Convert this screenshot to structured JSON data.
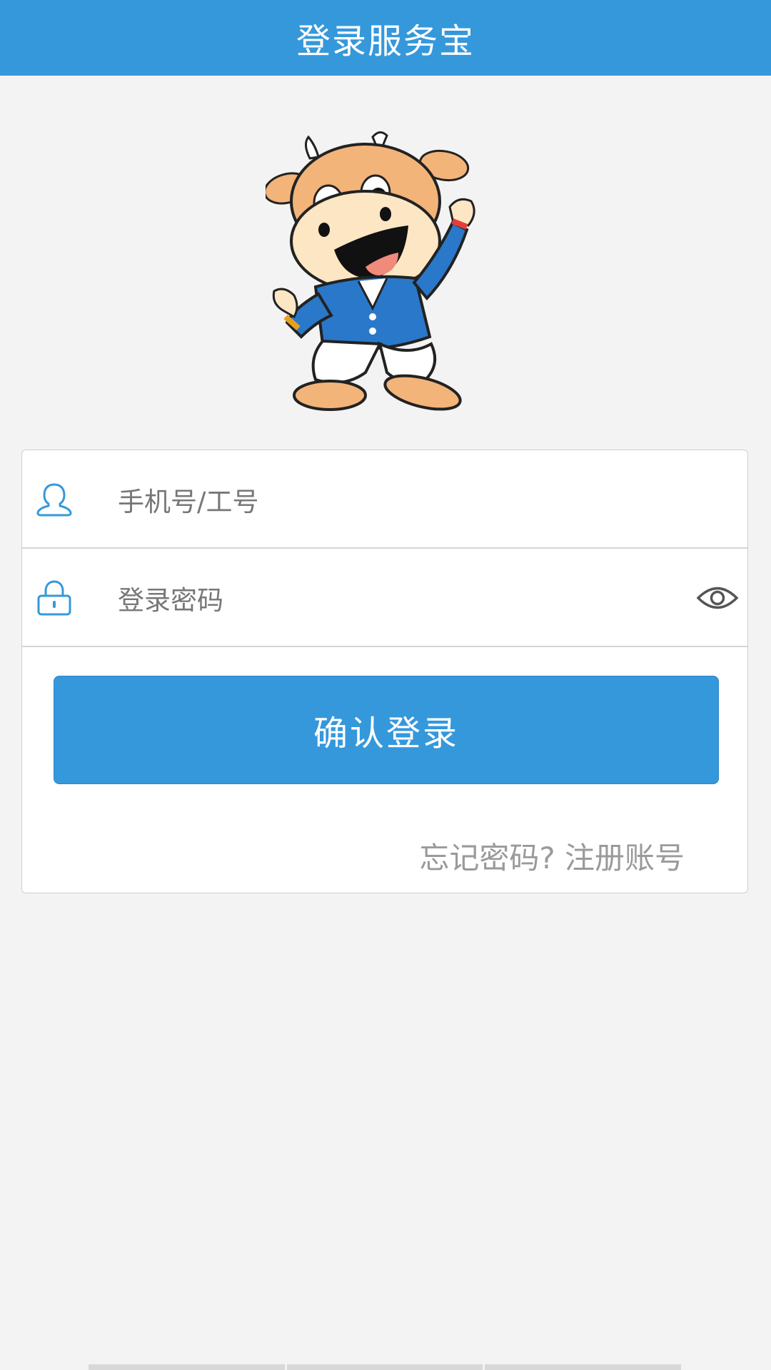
{
  "header": {
    "title": "登录服务宝"
  },
  "form": {
    "account_placeholder": "手机号/工号",
    "password_placeholder": "登录密码",
    "login_label": "确认登录",
    "forgot_label": "忘记密码?",
    "register_label": "注册账号"
  },
  "icons": {
    "account": "user-icon",
    "password": "lock-icon",
    "toggle": "eye-icon",
    "mascot": "cow-mascot"
  },
  "colors": {
    "primary": "#3598db",
    "background": "#f3f3f3",
    "link": "#9a9a9a"
  }
}
